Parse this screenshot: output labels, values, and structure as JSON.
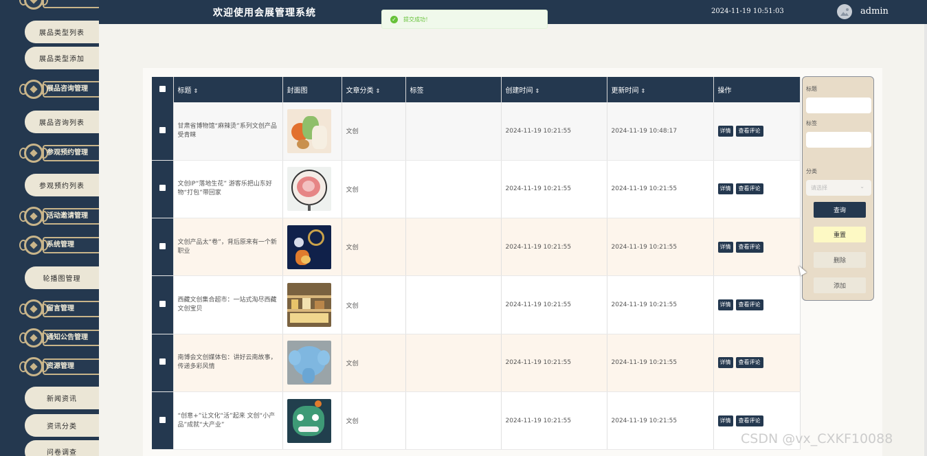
{
  "header": {
    "title": "欢迎使用会展管理系统",
    "datetime": "2024-11-19 10:51:03",
    "username": "admin"
  },
  "toast": {
    "message": "提交成功！"
  },
  "sidebar": {
    "items": [
      {
        "type": "pill",
        "label": "展品类型列表"
      },
      {
        "type": "pill",
        "label": "展品类型添加"
      },
      {
        "type": "group",
        "label": "展品咨询管理"
      },
      {
        "type": "pill",
        "label": "展品咨询列表"
      },
      {
        "type": "group",
        "label": "参观预约管理"
      },
      {
        "type": "pill",
        "label": "参观预约列表"
      },
      {
        "type": "group",
        "label": "活动邀请管理"
      },
      {
        "type": "group",
        "label": "系统管理"
      },
      {
        "type": "pill",
        "label": "轮播图管理"
      },
      {
        "type": "group",
        "label": "留言管理"
      },
      {
        "type": "group",
        "label": "通知公告管理"
      },
      {
        "type": "group",
        "label": "资源管理"
      },
      {
        "type": "pill",
        "label": "新闻资讯"
      },
      {
        "type": "pill",
        "label": "资讯分类"
      },
      {
        "type": "pill",
        "label": "问卷调查"
      }
    ]
  },
  "table": {
    "columns": [
      "标题",
      "封面图",
      "文章分类",
      "标签",
      "创建时间",
      "更新时间",
      "操作"
    ],
    "rows": [
      {
        "title": "甘肃省博物馆“麻辣烫”系列文创产品受青睐",
        "category": "文创",
        "tag": "",
        "created": "2024-11-19 10:21:55",
        "updated": "2024-11-19 10:48:17",
        "image": "food-figurine-photo"
      },
      {
        "title": "文创IP“落地生花” 游客乐把山东好物“打包”带回家",
        "category": "文创",
        "tag": "",
        "created": "2024-11-19 10:21:55",
        "updated": "2024-11-19 10:21:55",
        "image": "peony-fan-photo"
      },
      {
        "title": "文创产品太“卷”，背后原来有一个新职业",
        "category": "文创",
        "tag": "",
        "created": "2024-11-19 10:21:55",
        "updated": "2024-11-19 10:21:55",
        "image": "keychain-photo"
      },
      {
        "title": "西藏文创集合超市：一站式淘尽西藏文创宝贝",
        "category": "文创",
        "tag": "",
        "created": "2024-11-19 10:21:55",
        "updated": "2024-11-19 10:21:55",
        "image": "shop-shelf-photo"
      },
      {
        "title": "南博会文创媒体包：讲好云南故事，传递多彩风情",
        "category": "文创",
        "tag": "",
        "created": "2024-11-19 10:21:55",
        "updated": "2024-11-19 10:21:55",
        "image": "blue-elephant-photo"
      },
      {
        "title": "“创意+”让文化“活”起来 文创“小产品”成就“大产业”",
        "category": "文创",
        "tag": "",
        "created": "2024-11-19 10:21:55",
        "updated": "2024-11-19 10:21:55",
        "image": "green-dragon-photo"
      }
    ],
    "actions": {
      "detail": "详情",
      "comments": "查看评论"
    }
  },
  "search": {
    "title_label": "标题",
    "tag_label": "标签",
    "category_label": "分类",
    "category_placeholder": "请选择",
    "query_button": "查询",
    "reset_button": "重置",
    "delete_button": "删除",
    "add_button": "添加"
  },
  "watermark": "CSDN @vx_CXKF10088",
  "colors": {
    "nav": "#24384f",
    "gold": "#c9b58a",
    "pill": "#ebe6d6",
    "reset": "#fdf9c4",
    "success": "#67c23a"
  }
}
